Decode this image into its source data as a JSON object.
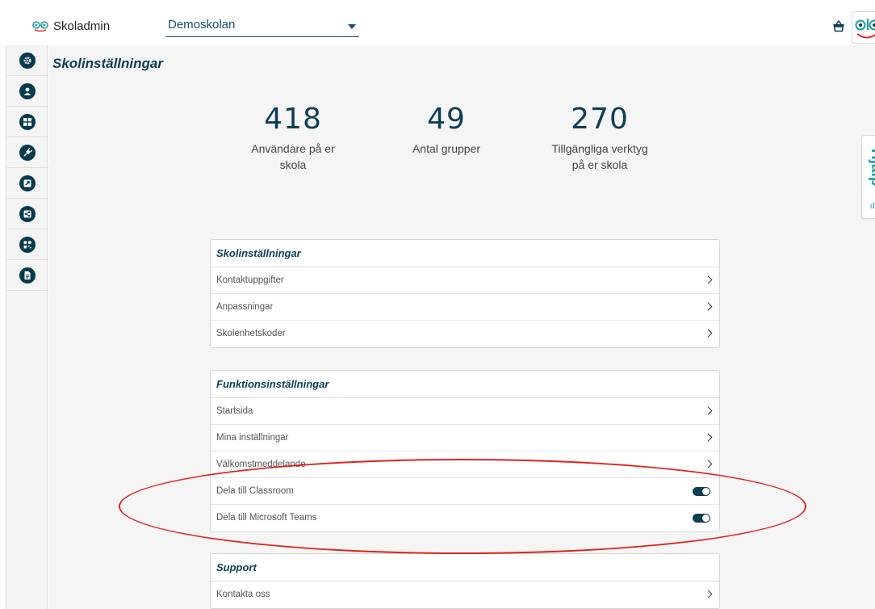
{
  "app": {
    "title": "Skoladmin"
  },
  "school_select": {
    "value": "Demoskolan"
  },
  "page": {
    "title": "Skolinställningar"
  },
  "stats": [
    {
      "value": "418",
      "label_line1": "Användare på er",
      "label_line2": "skola"
    },
    {
      "value": "49",
      "label_line1": "Antal grupper",
      "label_line2": ""
    },
    {
      "value": "270",
      "label_line1": "Tillgängliga verktyg",
      "label_line2": "på er skola"
    }
  ],
  "help_tab": {
    "big": "Hjälp",
    "small": "dö"
  },
  "sidebar": {
    "items": [
      {
        "icon": "gear-icon"
      },
      {
        "icon": "user-icon"
      },
      {
        "icon": "grid-icon"
      },
      {
        "icon": "plug-icon"
      },
      {
        "icon": "external-link-icon"
      },
      {
        "icon": "share-icon"
      },
      {
        "icon": "qr-code-icon"
      },
      {
        "icon": "document-icon"
      }
    ]
  },
  "cards": {
    "school_settings": {
      "title": "Skolinställningar",
      "rows": [
        "Kontaktuppgifter",
        "Anpassningar",
        "Skolenhetskoder"
      ]
    },
    "function_settings": {
      "title": "Funktionsinställningar",
      "rows": [
        "Startsida",
        "Mina inställningar",
        "Välkomstmeddelande"
      ],
      "toggles": [
        {
          "label": "Dela till Classroom",
          "on": true
        },
        {
          "label": "Dela till Microsoft Teams",
          "on": true
        }
      ]
    },
    "support": {
      "title": "Support",
      "rows": [
        "Kontakta oss"
      ]
    }
  },
  "colors": {
    "primary": "#0c3e55",
    "accent": "#1a9fa7",
    "annotation": "#e3211b"
  }
}
